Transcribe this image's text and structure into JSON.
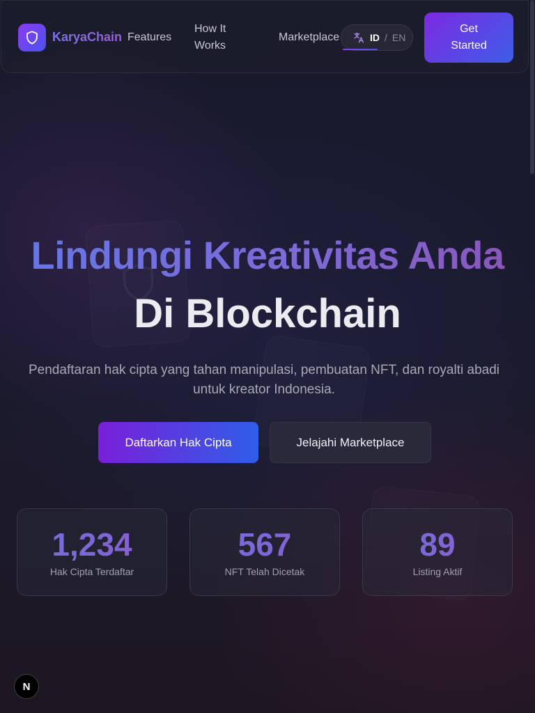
{
  "nav": {
    "brand": "KaryaChain",
    "links": {
      "features": "Features",
      "how_it_works": "How It Works",
      "marketplace": "Marketplace"
    },
    "lang": {
      "active": "ID",
      "separator": "/",
      "inactive": "EN"
    },
    "cta": "Get Started"
  },
  "hero": {
    "title_line1": "Lindungi Kreativitas Anda",
    "title_line2": "Di Blockchain",
    "subtitle": "Pendaftaran hak cipta yang tahan manipulasi, pembuatan NFT, dan royalti abadi untuk kreator Indonesia.",
    "primary_button": "Daftarkan Hak Cipta",
    "secondary_button": "Jelajahi Marketplace"
  },
  "stats": [
    {
      "value": "1,234",
      "label": "Hak Cipta Terdaftar"
    },
    {
      "value": "567",
      "label": "NFT Telah Dicetak"
    },
    {
      "value": "89",
      "label": "Listing Aktif"
    }
  ],
  "dev_badge": "N",
  "colors": {
    "accent_start": "#7d2ae0",
    "accent_end": "#3d5de8",
    "background": "#1a1a2e"
  },
  "icons": {
    "logo": "shield-icon",
    "language": "translate-icon"
  }
}
